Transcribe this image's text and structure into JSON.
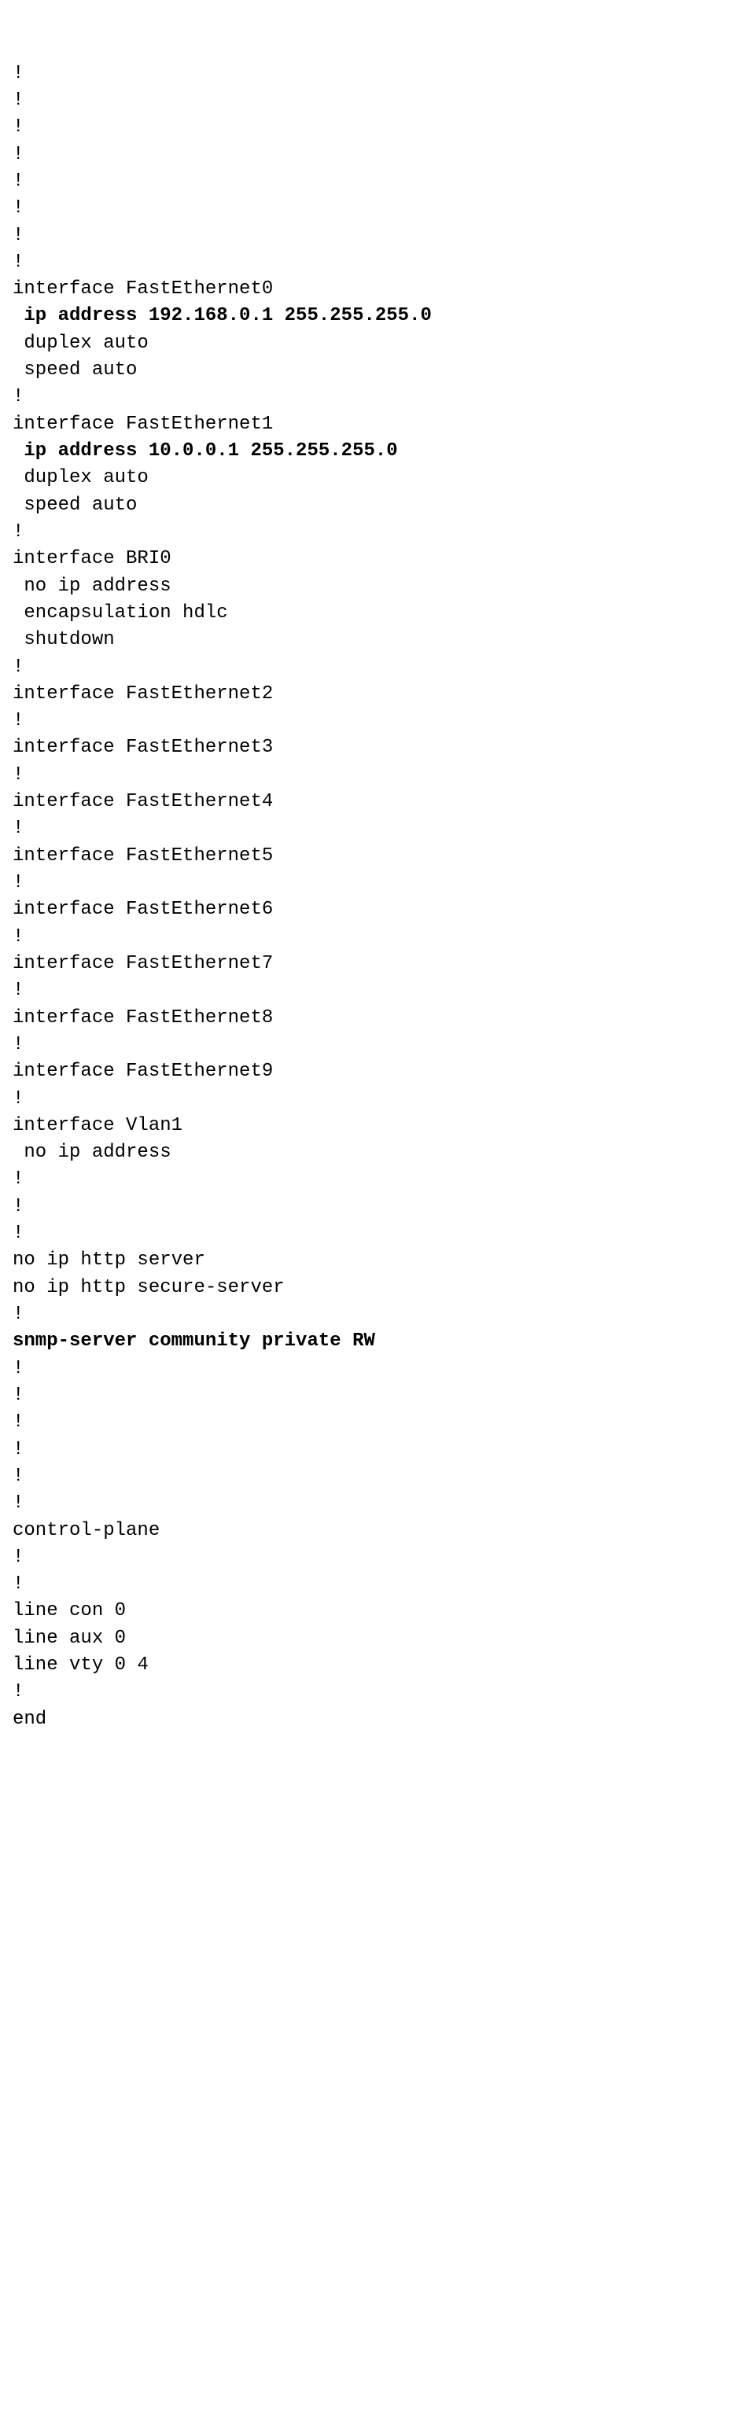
{
  "lines": [
    {
      "t": "!",
      "b": false
    },
    {
      "t": "!",
      "b": false
    },
    {
      "t": "!",
      "b": false
    },
    {
      "t": "!",
      "b": false
    },
    {
      "t": "!",
      "b": false
    },
    {
      "t": "!",
      "b": false
    },
    {
      "t": "!",
      "b": false
    },
    {
      "t": "!",
      "b": false
    },
    {
      "t": "interface FastEthernet0",
      "b": false
    },
    {
      "t": " ip address 192.168.0.1 255.255.255.0",
      "b": true
    },
    {
      "t": " duplex auto",
      "b": false
    },
    {
      "t": " speed auto",
      "b": false
    },
    {
      "t": "!",
      "b": false
    },
    {
      "t": "interface FastEthernet1",
      "b": false
    },
    {
      "t": " ip address 10.0.0.1 255.255.255.0",
      "b": true
    },
    {
      "t": " duplex auto",
      "b": false
    },
    {
      "t": " speed auto",
      "b": false
    },
    {
      "t": "!",
      "b": false
    },
    {
      "t": "interface BRI0",
      "b": false
    },
    {
      "t": " no ip address",
      "b": false
    },
    {
      "t": " encapsulation hdlc",
      "b": false
    },
    {
      "t": " shutdown",
      "b": false
    },
    {
      "t": "!",
      "b": false
    },
    {
      "t": "interface FastEthernet2",
      "b": false
    },
    {
      "t": "!",
      "b": false
    },
    {
      "t": "interface FastEthernet3",
      "b": false
    },
    {
      "t": "!",
      "b": false
    },
    {
      "t": "interface FastEthernet4",
      "b": false
    },
    {
      "t": "!",
      "b": false
    },
    {
      "t": "interface FastEthernet5",
      "b": false
    },
    {
      "t": "!",
      "b": false
    },
    {
      "t": "interface FastEthernet6",
      "b": false
    },
    {
      "t": "!",
      "b": false
    },
    {
      "t": "interface FastEthernet7",
      "b": false
    },
    {
      "t": "!",
      "b": false
    },
    {
      "t": "interface FastEthernet8",
      "b": false
    },
    {
      "t": "!",
      "b": false
    },
    {
      "t": "interface FastEthernet9",
      "b": false
    },
    {
      "t": "!",
      "b": false
    },
    {
      "t": "interface Vlan1",
      "b": false
    },
    {
      "t": " no ip address",
      "b": false
    },
    {
      "t": "!",
      "b": false
    },
    {
      "t": "!",
      "b": false
    },
    {
      "t": "!",
      "b": false
    },
    {
      "t": "no ip http server",
      "b": false
    },
    {
      "t": "no ip http secure-server",
      "b": false
    },
    {
      "t": "!",
      "b": false
    },
    {
      "t": "snmp-server community private RW",
      "b": true
    },
    {
      "t": "!",
      "b": false
    },
    {
      "t": "!",
      "b": false
    },
    {
      "t": "!",
      "b": false
    },
    {
      "t": "!",
      "b": false
    },
    {
      "t": "!",
      "b": false
    },
    {
      "t": "!",
      "b": false
    },
    {
      "t": "control-plane",
      "b": false
    },
    {
      "t": "!",
      "b": false
    },
    {
      "t": "!",
      "b": false
    },
    {
      "t": "line con 0",
      "b": false
    },
    {
      "t": "line aux 0",
      "b": false
    },
    {
      "t": "line vty 0 4",
      "b": false
    },
    {
      "t": "!",
      "b": false
    },
    {
      "t": "end",
      "b": false
    }
  ]
}
